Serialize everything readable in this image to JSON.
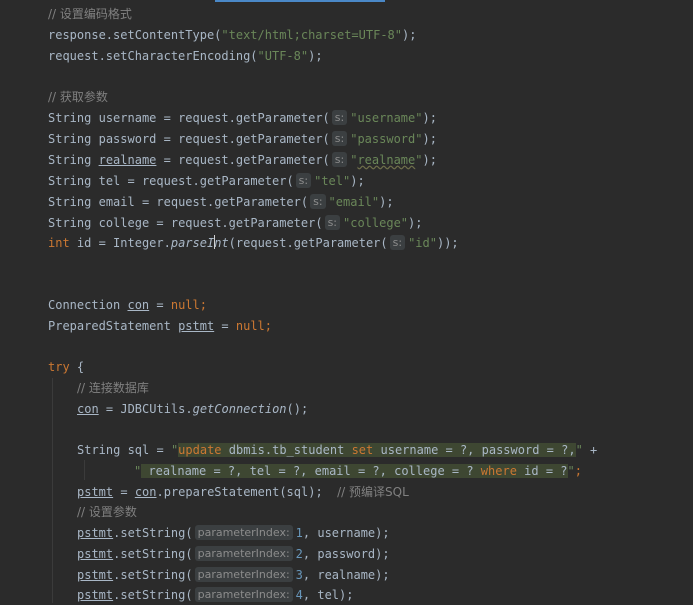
{
  "comments": {
    "set_encoding": "// 设置编码格式",
    "get_params": "// 获取参数",
    "connect_db": "// 连接数据库",
    "precompile_sql": "// 预编译SQL",
    "set_params": "// 设置参数"
  },
  "code": {
    "content_type_call": "response.setContentType(",
    "content_type_value": "\"text/html;charset=UTF-8\"",
    "char_enc_call": "request.setCharacterEncoding(",
    "char_enc_value": "\"UTF-8\"",
    "end_paren_semi": ");",
    "string_type": "String",
    "int_type": "int",
    "get_param_prefix": " = request.getParameter(",
    "param_hint": "s:",
    "username_var": "username",
    "username_str": "\"username\"",
    "password_var": "password",
    "password_str": "\"password\"",
    "realname_var": "realname",
    "realname_str_q1": "\"",
    "realname_str_word": "realname",
    "realname_str_q2": "\"",
    "tel_var": "tel",
    "tel_str": "\"tel\"",
    "email_var": "email",
    "email_str": "\"email\"",
    "college_var": "college",
    "college_str": "\"college\"",
    "id_var": "id",
    "integer_prefix": " = Integer.",
    "parse_a": "parseI",
    "parse_b": "nt",
    "parse_inner": "(request.getParameter(",
    "id_str": "\"id\"",
    "end_double": "));",
    "connection_type": "Connection",
    "con_var": "con",
    "assign": " = ",
    "null_kw": "null",
    "semi": ";",
    "prepared_type": "PreparedStatement",
    "pstmt_var": "pstmt",
    "try_kw": "try",
    "open_brace": " {",
    "jdbc_prefix": " = JDBCUtils.",
    "get_connection": "getConnection",
    "call_end": "();",
    "sql_var": " sql = ",
    "sql_q": "\"",
    "sql_update_kw": "update",
    "sql_table": " dbmis.tb_student ",
    "sql_set_kw": "set",
    "sql_rest1": " username = ?, password = ?,",
    "sql_q_end": "\"",
    "plus": " +",
    "sql_line2_text": " realname = ?, tel = ?, email = ?, college = ? ",
    "sql_where_kw": "where",
    "sql_line2_tail": " id = ?",
    "prepare_mid": ".prepareStatement(sql);",
    "set_string": ".setString(",
    "param_index_hint": "parameterIndex:",
    "n1": "1",
    "n2": "2",
    "n3": "3",
    "n4": "4",
    "arg_username": ", username);",
    "arg_password": ", password);",
    "arg_realname": ", realname);",
    "arg_tel": ", tel);"
  },
  "colors": {
    "background": "#2b2b2b",
    "keyword": "#cc7832",
    "string": "#6a8759",
    "comment": "#808080",
    "default_text": "#a9b7c6",
    "sql_highlight": "#3e4732"
  }
}
